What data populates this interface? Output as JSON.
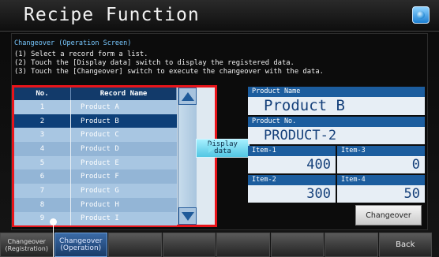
{
  "title": "Recipe Function",
  "panel": {
    "heading": "Changeover (Operation Screen)",
    "steps": [
      "(1) Select a record form a list.",
      "(2) Touch the [Display data] switch to display the registered data.",
      "(3) Touch the [Changeover] switch to execute the changeover with the data."
    ]
  },
  "list": {
    "headers": {
      "no": "No.",
      "name": "Record Name"
    },
    "rows": [
      {
        "no": "1",
        "name": "Product A"
      },
      {
        "no": "2",
        "name": "Product B"
      },
      {
        "no": "3",
        "name": "Product C"
      },
      {
        "no": "4",
        "name": "Product D"
      },
      {
        "no": "5",
        "name": "Product E"
      },
      {
        "no": "6",
        "name": "Product F"
      },
      {
        "no": "7",
        "name": "Product G"
      },
      {
        "no": "8",
        "name": "Product H"
      },
      {
        "no": "9",
        "name": "Product I"
      }
    ],
    "selected_index": 1
  },
  "display_button": {
    "line1": "Display",
    "line2": "data"
  },
  "product": {
    "name_label": "Product Name",
    "name_value": "Product B",
    "no_label": "Product No.",
    "no_value": "PRODUCT-2",
    "items": [
      {
        "label": "Item-1",
        "value": "400"
      },
      {
        "label": "Item-3",
        "value": "0"
      },
      {
        "label": "Item-2",
        "value": "300"
      },
      {
        "label": "Item-4",
        "value": "50"
      }
    ]
  },
  "changeover_button": "Changeover",
  "bottom_buttons": [
    {
      "line1": "Changeover",
      "line2": "(Registration)"
    },
    {
      "line1": "Changeover",
      "line2": "(Operation)"
    },
    {
      "line1": "",
      "line2": ""
    },
    {
      "line1": "",
      "line2": ""
    },
    {
      "line1": "",
      "line2": ""
    },
    {
      "line1": "",
      "line2": ""
    },
    {
      "line1": "",
      "line2": ""
    },
    {
      "line1": "Back",
      "line2": ""
    }
  ],
  "colors": {
    "highlight_border": "#e8141a",
    "selected_row": "#0d3f78",
    "header_bg": "#123a6a",
    "label_bg": "#1c5d9e",
    "display_button": "#7fe0f2"
  }
}
